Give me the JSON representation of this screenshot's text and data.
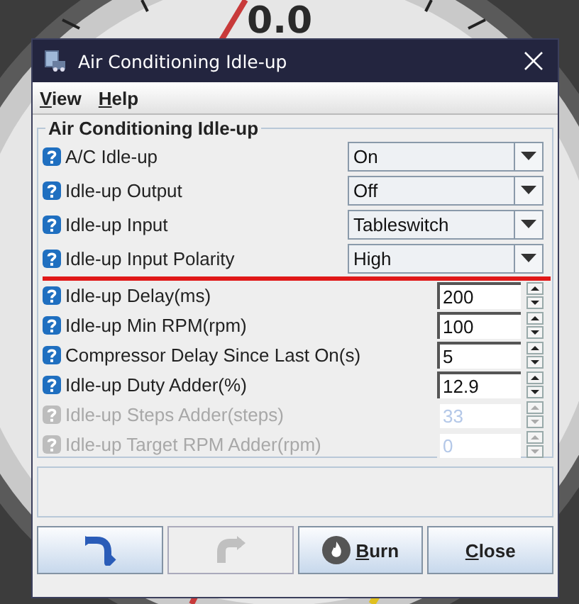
{
  "gauge": {
    "reading": "0.0"
  },
  "window": {
    "title": "Air Conditioning Idle-up"
  },
  "menu": [
    {
      "label": "View"
    },
    {
      "label": "Help"
    }
  ],
  "panel": {
    "title": "Air Conditioning Idle-up",
    "settings": [
      {
        "kind": "dropdown",
        "label": "A/C Idle-up",
        "value": "On",
        "disabled": false
      },
      {
        "kind": "dropdown",
        "label": "Idle-up Output",
        "value": "Off",
        "disabled": false
      },
      {
        "kind": "dropdown",
        "label": "Idle-up Input",
        "value": "Tableswitch",
        "disabled": false
      },
      {
        "kind": "dropdown",
        "label": "Idle-up Input Polarity",
        "value": "High",
        "disabled": false
      },
      {
        "kind": "spinner",
        "label": "Idle-up Delay(ms)",
        "value": "200",
        "disabled": false
      },
      {
        "kind": "spinner",
        "label": "Idle-up Min RPM(rpm)",
        "value": "100",
        "disabled": false
      },
      {
        "kind": "spinner",
        "label": "Compressor Delay Since Last On(s)",
        "value": "5",
        "disabled": false
      },
      {
        "kind": "spinner",
        "label": "Idle-up Duty Adder(%)",
        "value": "12.9",
        "disabled": false
      },
      {
        "kind": "spinner",
        "label": "Idle-up Steps Adder(steps)",
        "value": "33",
        "disabled": true
      },
      {
        "kind": "spinner",
        "label": "Idle-up Target RPM Adder(rpm)",
        "value": "0",
        "disabled": true
      }
    ]
  },
  "buttons": [
    {
      "kind": "undo",
      "disabled": false
    },
    {
      "kind": "redo",
      "disabled": true
    },
    {
      "kind": "burn",
      "label": "Burn",
      "disabled": false
    },
    {
      "kind": "text",
      "label": "Close",
      "disabled": false
    }
  ]
}
